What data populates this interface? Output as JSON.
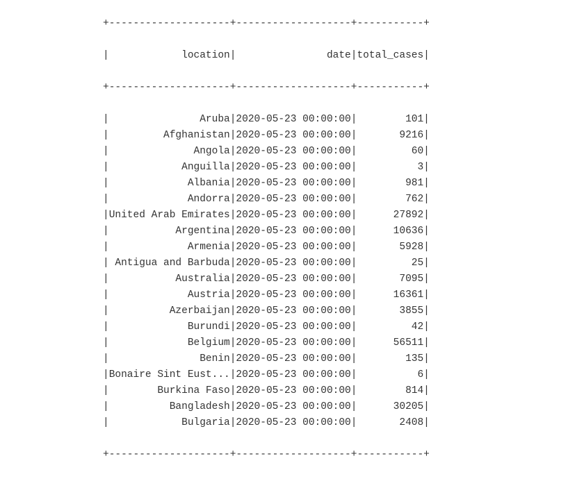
{
  "columns": {
    "location": {
      "header": "location",
      "width": 20,
      "align": "right"
    },
    "date": {
      "header": "date",
      "width": 19,
      "align": "right"
    },
    "total_cases": {
      "header": "total_cases",
      "width": 11,
      "align": "right"
    }
  },
  "rows": [
    {
      "location": "Aruba",
      "date": "2020-05-23 00:00:00",
      "total_cases": "101"
    },
    {
      "location": "Afghanistan",
      "date": "2020-05-23 00:00:00",
      "total_cases": "9216"
    },
    {
      "location": "Angola",
      "date": "2020-05-23 00:00:00",
      "total_cases": "60"
    },
    {
      "location": "Anguilla",
      "date": "2020-05-23 00:00:00",
      "total_cases": "3"
    },
    {
      "location": "Albania",
      "date": "2020-05-23 00:00:00",
      "total_cases": "981"
    },
    {
      "location": "Andorra",
      "date": "2020-05-23 00:00:00",
      "total_cases": "762"
    },
    {
      "location": "United Arab Emirates",
      "date": "2020-05-23 00:00:00",
      "total_cases": "27892"
    },
    {
      "location": "Argentina",
      "date": "2020-05-23 00:00:00",
      "total_cases": "10636"
    },
    {
      "location": "Armenia",
      "date": "2020-05-23 00:00:00",
      "total_cases": "5928"
    },
    {
      "location": "Antigua and Barbuda",
      "date": "2020-05-23 00:00:00",
      "total_cases": "25"
    },
    {
      "location": "Australia",
      "date": "2020-05-23 00:00:00",
      "total_cases": "7095"
    },
    {
      "location": "Austria",
      "date": "2020-05-23 00:00:00",
      "total_cases": "16361"
    },
    {
      "location": "Azerbaijan",
      "date": "2020-05-23 00:00:00",
      "total_cases": "3855"
    },
    {
      "location": "Burundi",
      "date": "2020-05-23 00:00:00",
      "total_cases": "42"
    },
    {
      "location": "Belgium",
      "date": "2020-05-23 00:00:00",
      "total_cases": "56511"
    },
    {
      "location": "Benin",
      "date": "2020-05-23 00:00:00",
      "total_cases": "135"
    },
    {
      "location": "Bonaire Sint Eust...",
      "date": "2020-05-23 00:00:00",
      "total_cases": "6"
    },
    {
      "location": "Burkina Faso",
      "date": "2020-05-23 00:00:00",
      "total_cases": "814"
    },
    {
      "location": "Bangladesh",
      "date": "2020-05-23 00:00:00",
      "total_cases": "30205"
    },
    {
      "location": "Bulgaria",
      "date": "2020-05-23 00:00:00",
      "total_cases": "2408"
    }
  ]
}
